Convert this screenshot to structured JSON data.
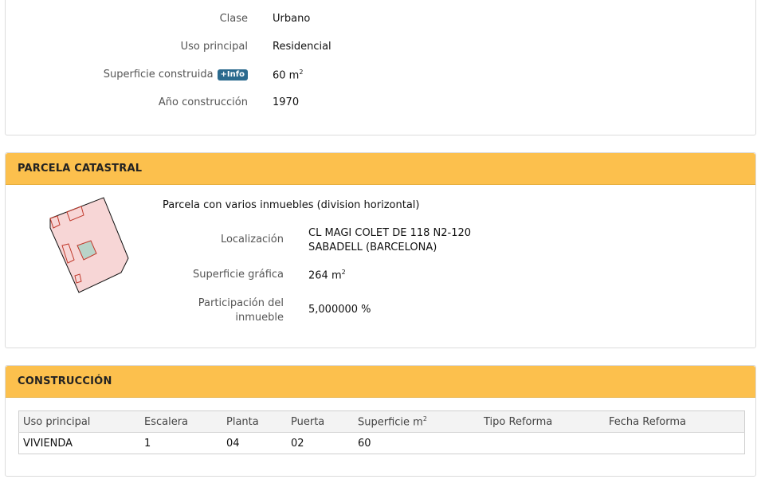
{
  "inmueble": {
    "clase_label": "Clase",
    "clase_value": "Urbano",
    "uso_label": "Uso principal",
    "uso_value": "Residencial",
    "superficie_label": "Superficie construida",
    "info_badge": "+Info",
    "superficie_value": "60 m",
    "superficie_unit_sup": "2",
    "anio_label": "Año construcción",
    "anio_value": "1970"
  },
  "parcela": {
    "header": "PARCELA CATASTRAL",
    "description": "Parcela con varios inmuebles (division horizontal)",
    "localizacion_label": "Localización",
    "localizacion_line1": "CL MAGI COLET DE 118 N2-120",
    "localizacion_line2": "SABADELL (BARCELONA)",
    "superficie_label": "Superficie gráfica",
    "superficie_value": "264 m",
    "superficie_unit_sup": "2",
    "participacion_label_line1": "Participación del",
    "participacion_label_line2": "inmueble",
    "participacion_value": "5,000000 %"
  },
  "construccion": {
    "header": "CONSTRUCCIÓN",
    "columns": [
      "Uso principal",
      "Escalera",
      "Planta",
      "Puerta",
      "Superficie m",
      "Tipo Reforma",
      "Fecha Reforma"
    ],
    "superficie_col_sup": "2",
    "rows": [
      [
        "VIVIENDA",
        "1",
        "04",
        "02",
        "60",
        "",
        ""
      ]
    ]
  },
  "colors": {
    "header_bg": "#fcc04d",
    "badge_bg": "#2b6a8e",
    "parcel_fill": "#f7d6d6",
    "parcel_inner_fill": "#b9d3c8"
  }
}
